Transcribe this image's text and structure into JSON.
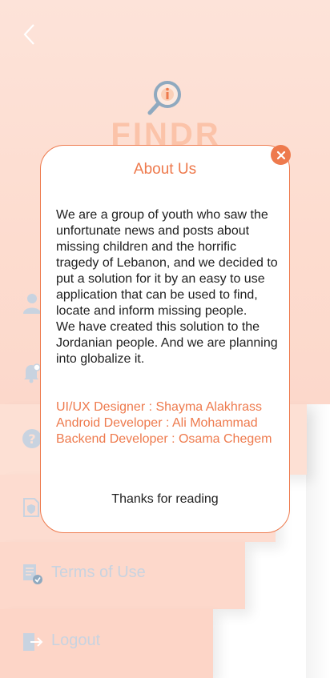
{
  "header": {
    "back_icon": "chevron-left-icon"
  },
  "brand": {
    "logo_icon": "magnifier-info-icon",
    "name": "FINDR"
  },
  "menu": {
    "items": [
      {
        "icon": "user-icon",
        "label": ""
      },
      {
        "icon": "bell-icon",
        "label": ""
      },
      {
        "icon": "question-icon",
        "label": ""
      },
      {
        "icon": "shield-document-icon",
        "label": ""
      },
      {
        "icon": "document-check-icon",
        "label": "Terms of Use"
      },
      {
        "icon": "logout-icon",
        "label": "Logout"
      }
    ]
  },
  "about_modal": {
    "title": "About Us",
    "close_icon": "close-icon",
    "paragraph1": "We are a group of youth who saw the unfortunate news and posts about missing children and the horrific tragedy of Lebanon, and we decided to put a solution for it by an easy to use application that can be used to find, locate and inform missing people.",
    "paragraph2": "We have created this solution to the Jordanian people. And we are planning into globalize it.",
    "credits": [
      "UI/UX  Designer : Shayma Alakhrass",
      "Android Developer : Ali Mohammad",
      "Backend Developer : Osama Chegem"
    ],
    "footer": "Thanks for reading"
  },
  "colors": {
    "accent": "#ee7a4d",
    "drawer_bg": "#fde0d4",
    "menu_text": "#c8d3e0"
  }
}
